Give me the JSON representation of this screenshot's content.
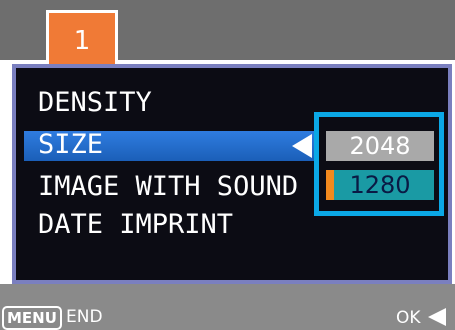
{
  "tab": {
    "number": "1",
    "color": "#f07a36"
  },
  "menu": {
    "items": [
      {
        "label": "DENSITY"
      },
      {
        "label": "SIZE",
        "selected": true
      },
      {
        "label": "IMAGE WITH SOUND"
      },
      {
        "label": "DATE IMPRINT"
      }
    ],
    "highlight_color": "#2f7ce0"
  },
  "size_options": {
    "highlighted": "2048",
    "current": "1280",
    "box_color": "#0ba8e6"
  },
  "footer": {
    "menu_key": "MENU",
    "menu_action": "END",
    "ok_label": "OK"
  },
  "icons": {
    "selection_arrow": "left-arrow-icon",
    "ok_arrow": "left-arrow-icon"
  }
}
